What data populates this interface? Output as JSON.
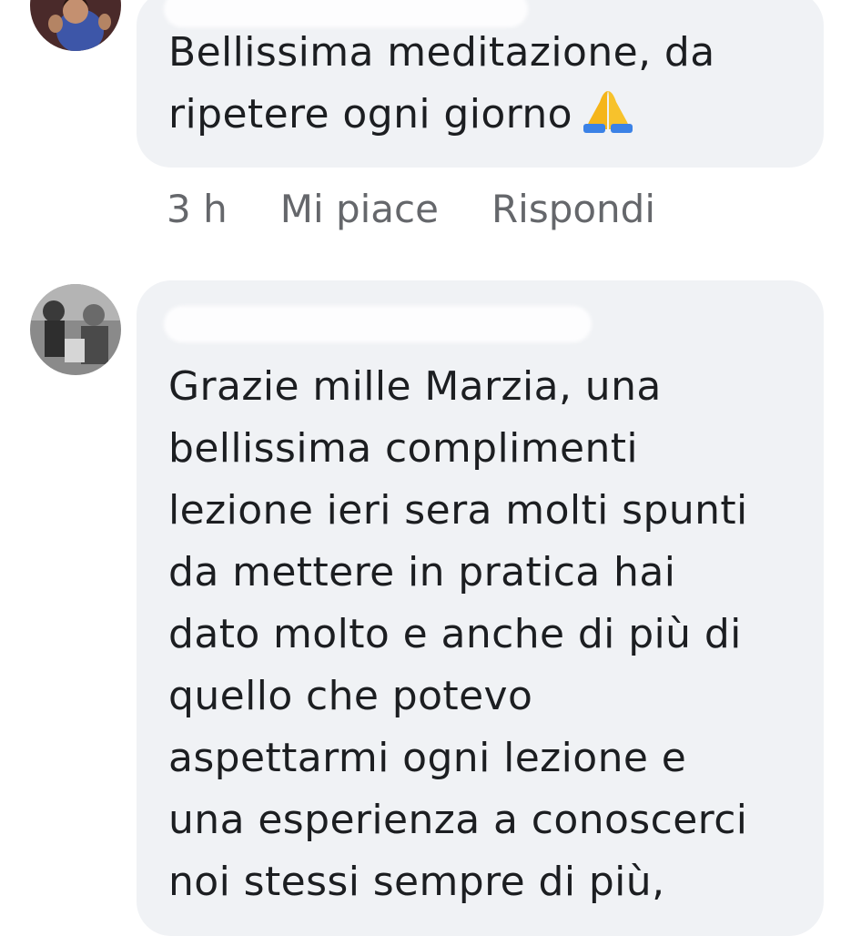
{
  "comments": [
    {
      "author": "",
      "text": "Bellissima meditazione, da\nripetere ogni giorno",
      "emoji": "folded-hands",
      "time": "3 h",
      "like_label": "Mi piace",
      "reply_label": "Rispondi"
    },
    {
      "author": "",
      "text": "Grazie mille Marzia, una\nbellissima complimenti\nlezione ieri sera molti spunti\nda mettere in pratica hai\ndato molto e anche di più  di\nquello che potevo\naspettarmi ogni lezione e\nuna esperienza a conoscerci\nnoi stessi sempre di più,"
    }
  ],
  "colors": {
    "bubble": "#f0f2f5",
    "meta_text": "#65676b",
    "text": "#1c1e21"
  }
}
